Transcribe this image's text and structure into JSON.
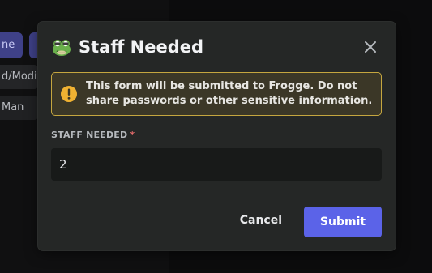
{
  "background": {
    "pill_1_text": "ne",
    "row_1_text": "d/Modif",
    "row_2_text": "Man"
  },
  "modal": {
    "title": "Staff Needed",
    "title_icon": "frog-icon",
    "close_icon": "close-icon",
    "notice": {
      "icon": "warning-icon",
      "text": "This form will be submitted to Frogge. Do not share passwords or other sensitive information."
    },
    "field": {
      "label": "STAFF NEEDED",
      "required_marker": "*",
      "value": "2"
    },
    "cancel_label": "Cancel",
    "submit_label": "Submit"
  },
  "colors": {
    "modal_bg": "#252726",
    "accent": "#5b63e8",
    "warning_border": "#c5a63f",
    "warning_icon": "#f0b232",
    "required": "#e46b6b"
  }
}
